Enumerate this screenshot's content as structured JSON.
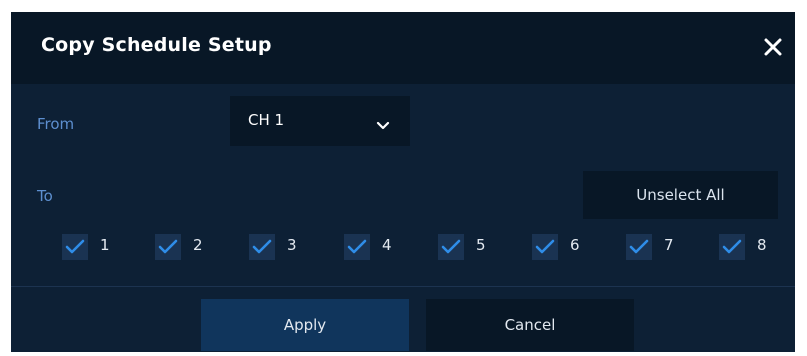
{
  "dialog": {
    "title": "Copy Schedule Setup",
    "close_icon": "close-icon"
  },
  "from": {
    "label": "From",
    "selected": "CH 1"
  },
  "to": {
    "label": "To",
    "unselect_all_label": "Unselect All",
    "channels": [
      {
        "label": "1",
        "checked": true
      },
      {
        "label": "2",
        "checked": true
      },
      {
        "label": "3",
        "checked": true
      },
      {
        "label": "4",
        "checked": true
      },
      {
        "label": "5",
        "checked": true
      },
      {
        "label": "6",
        "checked": true
      },
      {
        "label": "7",
        "checked": true
      },
      {
        "label": "8",
        "checked": true
      }
    ]
  },
  "footer": {
    "apply_label": "Apply",
    "cancel_label": "Cancel"
  },
  "colors": {
    "dialog_bg": "#0d2035",
    "header_bg": "#081726",
    "label_blue": "#5d8fcf",
    "check_blue": "#2f8de8",
    "apply_bg": "#10355c"
  }
}
